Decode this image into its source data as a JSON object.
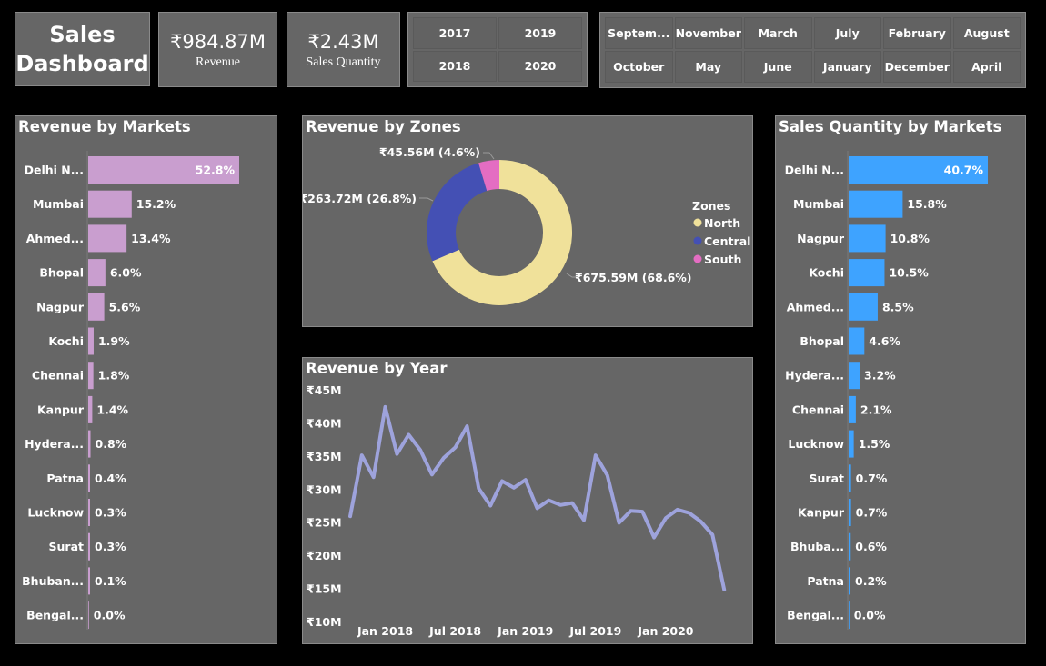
{
  "header": {
    "title_line1": "Sales",
    "title_line2": "Dashboard",
    "revenue_value": "₹984.87M",
    "revenue_label": "Revenue",
    "quantity_value": "₹2.43M",
    "quantity_label": "Sales Quantity"
  },
  "year_slicer": [
    "2017",
    "2019",
    "2018",
    "2020"
  ],
  "month_slicer": [
    "Septem...",
    "November",
    "March",
    "July",
    "February",
    "August",
    "October",
    "May",
    "June",
    "January",
    "December",
    "April"
  ],
  "colors": {
    "revenue_bar": "#c99ecf",
    "quantity_bar": "#3ea3ff",
    "line": "#9ea3dc",
    "north": "#f0e19a",
    "central": "#4450b4",
    "south": "#e46dc2",
    "panel": "#666666"
  },
  "chart_data": [
    {
      "type": "bar",
      "title": "Revenue by Markets",
      "categories": [
        "Delhi N...",
        "Mumbai",
        "Ahmed...",
        "Bhopal",
        "Nagpur",
        "Kochi",
        "Chennai",
        "Kanpur",
        "Hydera...",
        "Patna",
        "Lucknow",
        "Surat",
        "Bhuban...",
        "Bengal..."
      ],
      "values": [
        52.8,
        15.2,
        13.4,
        6.0,
        5.6,
        1.9,
        1.8,
        1.4,
        0.8,
        0.4,
        0.3,
        0.3,
        0.1,
        0.0
      ],
      "labels": [
        "52.8%",
        "15.2%",
        "13.4%",
        "6.0%",
        "5.6%",
        "1.9%",
        "1.8%",
        "1.4%",
        "0.8%",
        "0.4%",
        "0.3%",
        "0.3%",
        "0.1%",
        "0.0%"
      ]
    },
    {
      "type": "pie",
      "title": "Revenue by Zones",
      "legend_title": "Zones",
      "categories": [
        "North",
        "Central",
        "South"
      ],
      "values": [
        675.59,
        263.72,
        45.56
      ],
      "labels": [
        "₹675.59M (68.6%)",
        "₹263.72M (26.8%)",
        "₹45.56M (4.6%)"
      ],
      "legend_position": "right"
    },
    {
      "type": "line",
      "title": "Revenue by Year",
      "x": [
        "2017-10",
        "2017-11",
        "2017-12",
        "2018-01",
        "2018-02",
        "2018-03",
        "2018-04",
        "2018-05",
        "2018-06",
        "2018-07",
        "2018-08",
        "2018-09",
        "2018-10",
        "2018-11",
        "2018-12",
        "2019-01",
        "2019-02",
        "2019-03",
        "2019-04",
        "2019-05",
        "2019-06",
        "2019-07",
        "2019-08",
        "2019-09",
        "2019-10",
        "2019-11",
        "2019-12",
        "2020-01",
        "2020-02",
        "2020-03",
        "2020-04",
        "2020-05",
        "2020-06"
      ],
      "y": [
        25.9,
        35.1,
        31.8,
        42.4,
        35.3,
        38.2,
        35.9,
        32.2,
        34.7,
        36.3,
        39.5,
        30.1,
        27.5,
        31.2,
        30.2,
        31.4,
        27.1,
        28.3,
        27.6,
        27.9,
        25.3,
        35.1,
        32.1,
        24.9,
        26.7,
        26.6,
        22.7,
        25.6,
        26.9,
        26.4,
        25.1,
        23.1,
        14.8
      ],
      "y_ticks": [
        "₹45M",
        "₹40M",
        "₹35M",
        "₹30M",
        "₹25M",
        "₹20M",
        "₹15M",
        "₹10M"
      ],
      "x_ticks": [
        "Jan 2018",
        "Jul 2018",
        "Jan 2019",
        "Jul 2019",
        "Jan 2020"
      ],
      "ylim": [
        10,
        45
      ]
    },
    {
      "type": "bar",
      "title": "Sales Quantity by Markets",
      "categories": [
        "Delhi N...",
        "Mumbai",
        "Nagpur",
        "Kochi",
        "Ahmed...",
        "Bhopal",
        "Hydera...",
        "Chennai",
        "Lucknow",
        "Surat",
        "Kanpur",
        "Bhuba...",
        "Patna",
        "Bengal..."
      ],
      "values": [
        40.7,
        15.8,
        10.8,
        10.5,
        8.5,
        4.6,
        3.2,
        2.1,
        1.5,
        0.7,
        0.7,
        0.6,
        0.2,
        0.0
      ],
      "labels": [
        "40.7%",
        "15.8%",
        "10.8%",
        "10.5%",
        "8.5%",
        "4.6%",
        "3.2%",
        "2.1%",
        "1.5%",
        "0.7%",
        "0.7%",
        "0.6%",
        "0.2%",
        "0.0%"
      ]
    }
  ]
}
